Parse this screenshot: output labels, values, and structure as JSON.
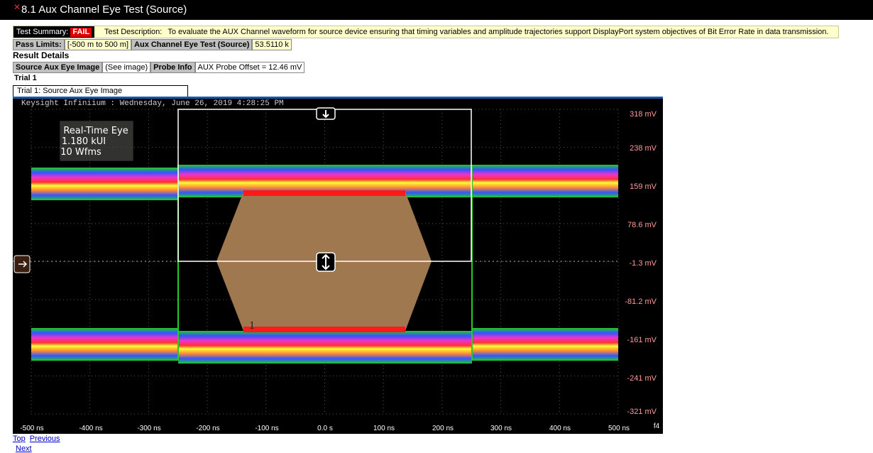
{
  "window": {
    "title": "8.1 Aux Channel Eye Test (Source)",
    "close_icon": "close-x-icon"
  },
  "summary": {
    "label": "Test Summary:",
    "result": "FAIL",
    "description_label": "Test Description:",
    "description": "To evaluate the AUX Channel waveform for source device ensuring that timing variables and amplitude trajectories support DisplayPort system objectives of Bit Error Rate in data transmission."
  },
  "limits": {
    "label": "Pass Limits:",
    "value": "[-500 m to 500 m]",
    "metric_label": "Aux Channel Eye Test (Source)",
    "metric_value": "53.5110 k"
  },
  "result_details": {
    "heading": "Result Details",
    "image_label": "Source Aux Eye Image",
    "image_value": "(See image)",
    "probe_label": "Probe Info",
    "probe_value": "AUX Probe Offset = 12.46 mV"
  },
  "trial": {
    "label": "Trial 1",
    "caption": "Trial 1: Source Aux Eye Image"
  },
  "scope": {
    "header": "Keysight Infiniium : Wednesday, June 26, 2019 4:28:25 PM",
    "info_box": [
      "Real-Time Eye",
      "1.180 kUI",
      "10 Wfms"
    ],
    "y_ticks": [
      "318 mV",
      "238 mV",
      "159 mV",
      "78.6 mV",
      "-1.3 mV",
      "-81.2 mV",
      "-161 mV",
      "-241 mV",
      "-321 mV"
    ],
    "x_ticks": [
      "-500 ns",
      "-400 ns",
      "-300 ns",
      "-200 ns",
      "-100 ns",
      "0.0 s",
      "100 ns",
      "200 ns",
      "300 ns",
      "400 ns",
      "500 ns"
    ],
    "channel_label": "f4",
    "marker_label": "1",
    "colors": {
      "background": "#000000",
      "mask": "#a07850",
      "mask_edge": "#ff1a1a",
      "axis_text": "#ff9a9a",
      "grid": "#666666"
    }
  },
  "footer": {
    "top": "Top",
    "previous": "Previous",
    "next": "Next"
  }
}
